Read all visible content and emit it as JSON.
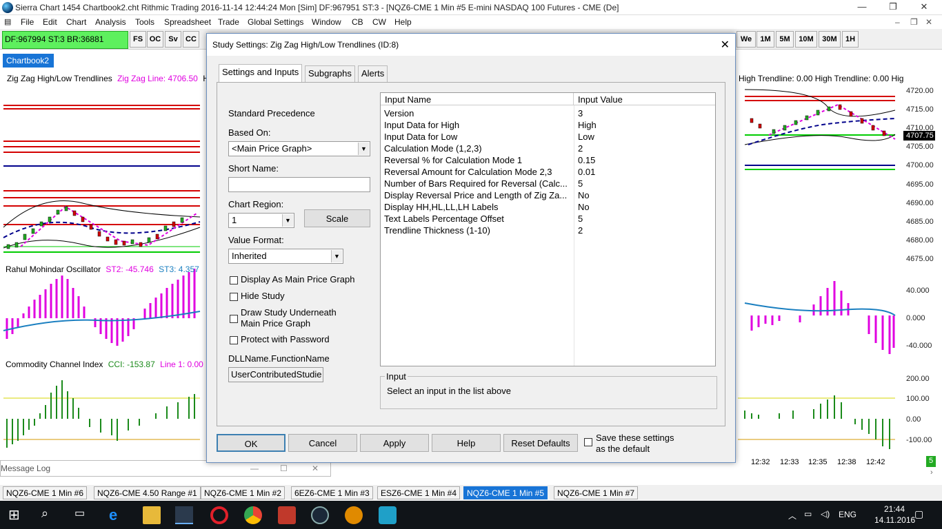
{
  "window": {
    "title": "Sierra Chart 1454 Chartbook2.cht  Rithmic Trading 2016-11-14  12:44:24 Mon [Sim]  DF:967951  ST:3 - [NQZ6-CME  1 Min  #5  E-mini NASDAQ 100 Futures - CME (De]"
  },
  "menu": [
    "File",
    "Edit",
    "Chart",
    "Analysis",
    "Tools",
    "Spreadsheet",
    "Trade",
    "Global Settings",
    "Window",
    "CB",
    "CW",
    "Help"
  ],
  "toolbar": {
    "status": "DF:967994  ST:3  BR:36881",
    "left_buttons": [
      "FS",
      "OC",
      "Sv",
      "CC"
    ],
    "right_buttons": [
      "We",
      "1M",
      "5M",
      "10M",
      "30M",
      "1H"
    ]
  },
  "chartbook_tab": "Chartbook2",
  "chart": {
    "legend_main": {
      "name": "Zig Zag High/Low Trendlines",
      "zz": "Zig Zag Line: 4706.50",
      "tail": "Hi"
    },
    "legend_right": "High Trendline: 0.00  High Trendline: 0.00  Hig",
    "osc": {
      "name": "Rahul Mohindar Oscillator",
      "st2": "ST2: -45.746",
      "st3": "ST3: 4.357"
    },
    "cci": {
      "name": "Commodity Channel Index",
      "cci": "CCI: -153.87",
      "line1": "Line 1: 0.00"
    },
    "price_labels": [
      "4720.00",
      "4715.00",
      "4710.00",
      "4705.00",
      "4700.00",
      "4695.00",
      "4690.00",
      "4685.00",
      "4680.00",
      "4675.00"
    ],
    "current_price": "4707.75",
    "osc_labels": [
      "40.000",
      "0.000",
      "-40.000"
    ],
    "cci_labels": [
      "200.00",
      "100.00",
      "0.00",
      "-100.00"
    ],
    "time_labels": [
      "12:32",
      "12:33",
      "12:35",
      "12:38",
      "12:42"
    ],
    "bottom_right_marker": "5"
  },
  "message_log": {
    "title": "Message Log"
  },
  "bottom_tabs": [
    {
      "label": "NQZ6-CME  1 Min  #6"
    },
    {
      "label": "NQZ6-CME  4.50 Range  #1"
    },
    {
      "label": "NQZ6-CME  1 Min  #2"
    },
    {
      "label": "6EZ6-CME  1 Min  #3"
    },
    {
      "label": "ESZ6-CME  1 Min  #4"
    },
    {
      "label": "NQZ6-CME  1 Min  #5"
    },
    {
      "label": "NQZ6-CME  1 Min  #7"
    }
  ],
  "dialog": {
    "title": "Study Settings: Zig Zag High/Low Trendlines (ID:8)",
    "tabs": [
      "Settings and Inputs",
      "Subgraphs",
      "Alerts"
    ],
    "standard_precedence": "Standard Precedence",
    "based_on_label": "Based On:",
    "based_on_value": "<Main Price Graph>",
    "short_name_label": "Short Name:",
    "short_name_value": "",
    "chart_region_label": "Chart Region:",
    "chart_region_value": "1",
    "scale_button": "Scale",
    "value_format_label": "Value Format:",
    "value_format_value": "Inherited",
    "checkboxes": [
      "Display As Main Price Graph",
      "Hide Study",
      "Draw Study Underneath\nMain Price Graph",
      "Protect with Password"
    ],
    "dll_label": "DLLName.FunctionName",
    "dll_value": "UserContributedStudie",
    "grid_headers": [
      "Input Name",
      "Input Value"
    ],
    "inputs": [
      {
        "name": "Version",
        "value": "3"
      },
      {
        "name": "Input Data for High",
        "value": "High"
      },
      {
        "name": "Input Data for Low",
        "value": "Low"
      },
      {
        "name": "Calculation Mode (1,2,3)",
        "value": "2"
      },
      {
        "name": "Reversal % for Calculation Mode 1",
        "value": "0.15"
      },
      {
        "name": "Reversal Amount for Calculation Mode 2,3",
        "value": "0.01"
      },
      {
        "name": "Number of Bars Required for Reversal (Calc...",
        "value": "5"
      },
      {
        "name": "Display Reversal Price and Length of Zig Za...",
        "value": "No"
      },
      {
        "name": "Display HH,HL,LL,LH Labels",
        "value": "No"
      },
      {
        "name": "Text Labels Percentage Offset",
        "value": "5"
      },
      {
        "name": "Trendline Thickness (1-10)",
        "value": "2"
      }
    ],
    "input_box_label": "Input",
    "input_box_text": "Select an input in the list above",
    "buttons": [
      "OK",
      "Cancel",
      "Apply",
      "Help",
      "Reset Defaults"
    ],
    "save_default": "Save these settings\nas the default"
  },
  "taskbar": {
    "lang": "ENG",
    "time": "21:44",
    "date": "14.11.2016"
  },
  "colors": {
    "accent": "#1874d6",
    "status_green": "#5ef05e",
    "red_line": "#d40000",
    "blue_line": "#00008b",
    "green_line": "#00cc00",
    "magenta": "#e000e0",
    "osc_line": "#1a7fc0",
    "cci_bar": "#1a8a1a"
  }
}
